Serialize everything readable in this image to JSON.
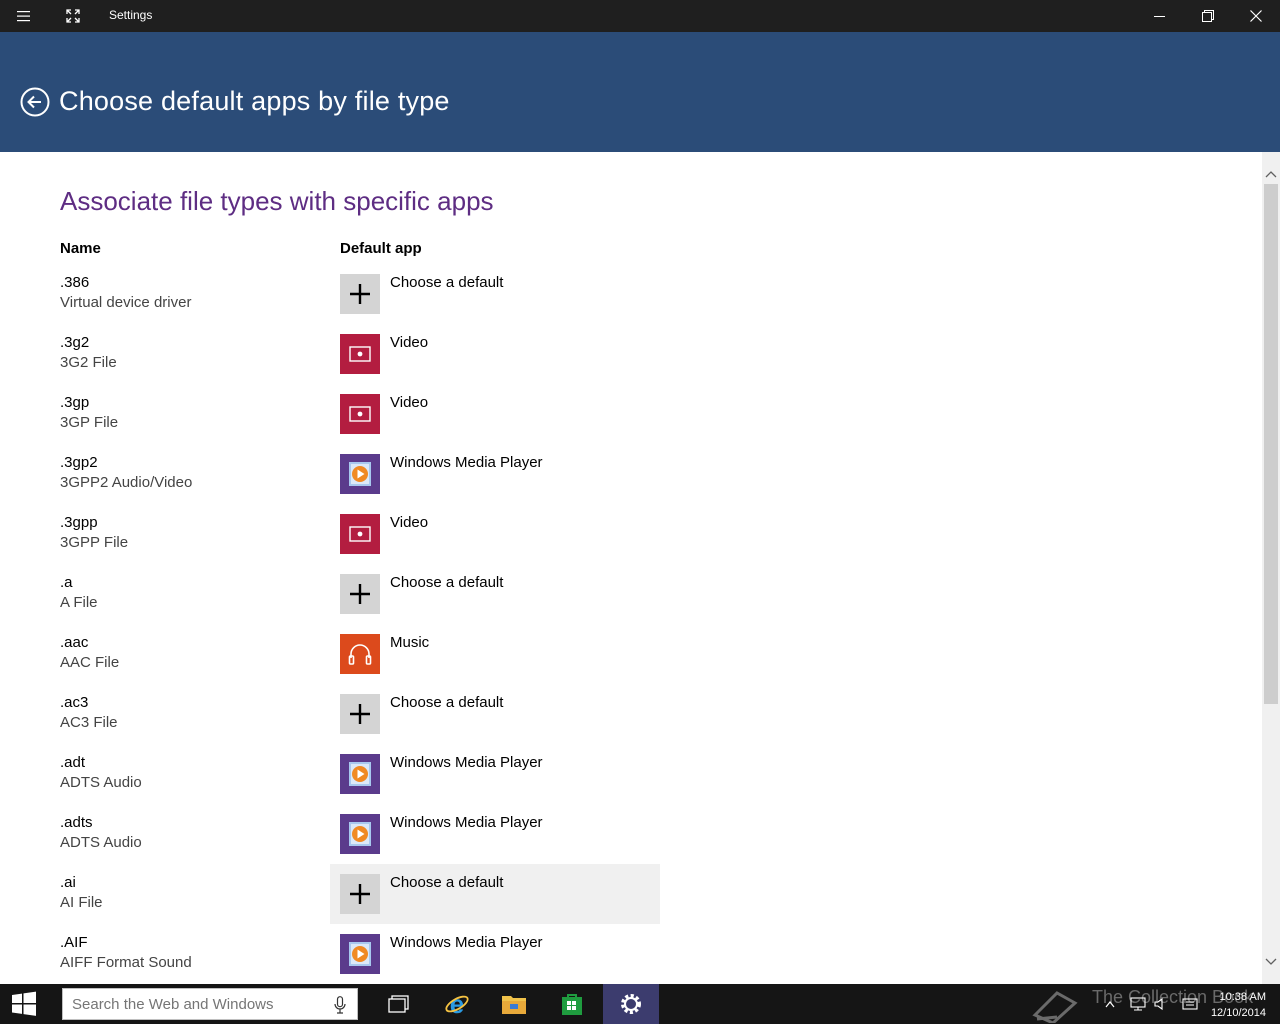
{
  "window": {
    "title": "Settings"
  },
  "header": {
    "title": "Choose default apps by file type"
  },
  "section": {
    "title": "Associate file types with specific apps",
    "col_name": "Name",
    "col_app": "Default app"
  },
  "rows": [
    {
      "ext": ".386",
      "desc": "Virtual device driver",
      "app": "Choose a default",
      "icon": "plus-icon"
    },
    {
      "ext": ".3g2",
      "desc": "3G2 File",
      "app": "Video",
      "icon": "video-app-icon"
    },
    {
      "ext": ".3gp",
      "desc": "3GP File",
      "app": "Video",
      "icon": "video-app-icon"
    },
    {
      "ext": ".3gp2",
      "desc": "3GPP2 Audio/Video",
      "app": "Windows Media Player",
      "icon": "windows-media-player-icon"
    },
    {
      "ext": ".3gpp",
      "desc": "3GPP File",
      "app": "Video",
      "icon": "video-app-icon"
    },
    {
      "ext": ".a",
      "desc": "A File",
      "app": "Choose a default",
      "icon": "plus-icon"
    },
    {
      "ext": ".aac",
      "desc": "AAC File",
      "app": "Music",
      "icon": "music-app-icon"
    },
    {
      "ext": ".ac3",
      "desc": "AC3 File",
      "app": "Choose a default",
      "icon": "plus-icon"
    },
    {
      "ext": ".adt",
      "desc": "ADTS Audio",
      "app": "Windows Media Player",
      "icon": "windows-media-player-icon"
    },
    {
      "ext": ".adts",
      "desc": "ADTS Audio",
      "app": "Windows Media Player",
      "icon": "windows-media-player-icon"
    },
    {
      "ext": ".ai",
      "desc": "AI File",
      "app": "Choose a default",
      "icon": "plus-icon"
    },
    {
      "ext": ".AIF",
      "desc": "AIFF Format Sound",
      "app": "Windows Media Player",
      "icon": "windows-media-player-icon"
    }
  ],
  "taskbar": {
    "search_placeholder": "Search the Web and Windows",
    "time": "10:38 AM",
    "date": "12/10/2014",
    "watermark": "The Collection Book"
  },
  "colors": {
    "header_bg": "#2b4c78",
    "section_title": "#5e2d83",
    "video_tile": "#b31d40",
    "wmp_tile": "#5b3b8c",
    "music_tile": "#dc4a1c",
    "choose_tile": "#d4d4d4"
  }
}
